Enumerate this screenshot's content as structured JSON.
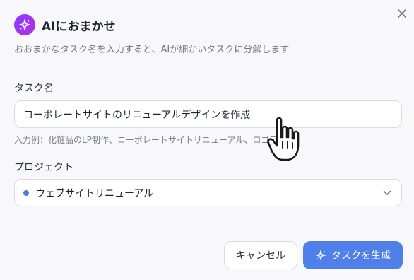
{
  "dialog": {
    "title": "AIにおまかせ",
    "subtitle": "おおまかなタスク名を入力すると、AIが細かいタスクに分解します",
    "close_icon": "close-icon",
    "badge_icon": "sparkle-icon"
  },
  "task_field": {
    "label": "タスク名",
    "value": "コーポレートサイトのリニューアルデザインを作成",
    "hint": "入力例：化粧品のLP制作、コーポレートサイトリニューアル、ロゴデ"
  },
  "project_field": {
    "label": "プロジェクト",
    "selected": "ウェブサイトリニューアル",
    "dot_color": "#4a7de8",
    "chevron_icon": "chevron-down-icon"
  },
  "buttons": {
    "cancel": "キャンセル",
    "generate": "タスクを生成",
    "generate_icon": "sparkle-icon"
  },
  "colors": {
    "accent": "#4f7fe9",
    "badge_gradient_start": "#8b3dff",
    "badge_gradient_end": "#b02ee8"
  },
  "cursor": "hand-pointer-icon"
}
